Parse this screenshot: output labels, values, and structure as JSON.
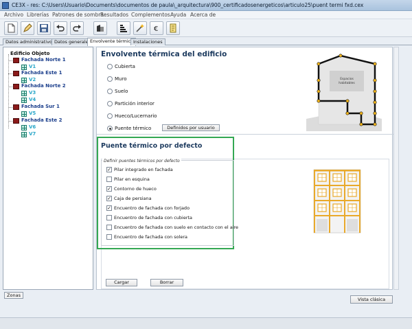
{
  "window": {
    "title": "CE3X - res: C:\\Users\\Usuario\\Documents\\documentos de paula\\_arquitectura\\900_certificadosenergeticos\\articulo25\\puent termi fxd.cex"
  },
  "menu": [
    "Archivo",
    "Librerías",
    "Patrones de sombra",
    "Resultados",
    "Complementos",
    "Ayuda",
    "Acerca de"
  ],
  "tabs": [
    "Datos administrativos",
    "Datos generales",
    "Envolvente térmica",
    "Instalaciones"
  ],
  "active_tab": "Envolvente térmica",
  "tree": {
    "root": "Edificio Objeto",
    "facades": [
      {
        "name": "Fachada Norte 1",
        "windows": [
          "V1"
        ]
      },
      {
        "name": "Fachada Este 1",
        "windows": [
          "V2"
        ]
      },
      {
        "name": "Fachada Norte 2",
        "windows": [
          "V3",
          "V4"
        ]
      },
      {
        "name": "Fachada Sur 1",
        "windows": [
          "V5"
        ]
      },
      {
        "name": "Fachada Este 2",
        "windows": [
          "V6",
          "V7"
        ]
      }
    ]
  },
  "envolvente": {
    "title": "Envolvente térmica del edificio",
    "options": [
      "Cubierta",
      "Muro",
      "Suelo",
      "Partición interior",
      "Hueco/Lucernario",
      "Puente térmico"
    ],
    "selected": "Puente térmico",
    "defined_by_user_button": "Definidos por usuario",
    "diagram_label_line1": "Espacios",
    "diagram_label_line2": "habitables"
  },
  "puente": {
    "title": "Puente térmico por defecto",
    "group_label": "Definir puentes térmicos por defecto",
    "items": [
      {
        "label": "Pilar integrado en fachada",
        "checked": true
      },
      {
        "label": "Pilar en esquina",
        "checked": false
      },
      {
        "label": "Contorno de hueco",
        "checked": true
      },
      {
        "label": "Caja de persiana",
        "checked": true
      },
      {
        "label": "Encuentro de fachada con forjado",
        "checked": true
      },
      {
        "label": "Encuentro de fachada con cubierta",
        "checked": false
      },
      {
        "label": "Encuentro de fachada con suelo en contacto con el aire",
        "checked": false
      },
      {
        "label": "Encuentro de fachada con solera",
        "checked": false
      }
    ]
  },
  "buttons": {
    "cargar": "Cargar",
    "borrar": "Borrar",
    "zonas": "Zonas",
    "vista_clasica": "Vista clásica"
  },
  "colors": {
    "highlight_box": "#34a853",
    "heading": "#1c3a5e",
    "facade_text": "#1c3f8c",
    "window_text": "#2aa7c9",
    "bridge_marker": "#f2b51b"
  }
}
